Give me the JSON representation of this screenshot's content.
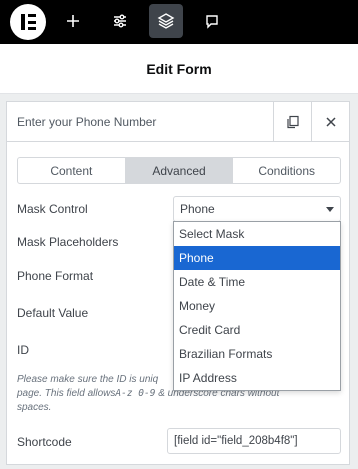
{
  "toolbar": {
    "buttons": [
      "add",
      "settings",
      "structure",
      "comments"
    ]
  },
  "header": {
    "title": "Edit Form"
  },
  "field": {
    "label": "Enter your Phone Number",
    "tabs": [
      "Content",
      "Advanced",
      "Conditions"
    ],
    "active_tab": "Advanced",
    "mask_control_label": "Mask Control",
    "mask_control_value": "Phone",
    "mask_placeholders_label": "Mask Placeholders",
    "phone_format_label": "Phone Format",
    "default_value_label": "Default Value",
    "id_label": "ID",
    "id_help_1": "Please make sure the ID is uniq",
    "id_help_2": "page. This field allows",
    "id_help_code": "A-z 0-9",
    "id_help_3": " & underscore chars without",
    "id_help_4": "spaces.",
    "shortcode_label": "Shortcode",
    "shortcode_value": "[field id=\"field_208b4f8\"]"
  },
  "dropdown": {
    "options": [
      "Select Mask",
      "Phone",
      "Date & Time",
      "Money",
      "Credit Card",
      "Brazilian Formats",
      "IP Address"
    ],
    "selected": "Phone"
  },
  "colors": {
    "toolbar_bg": "#000000",
    "active_tab_bg": "#d5d8dc",
    "selected_option_bg": "#1967d2"
  }
}
